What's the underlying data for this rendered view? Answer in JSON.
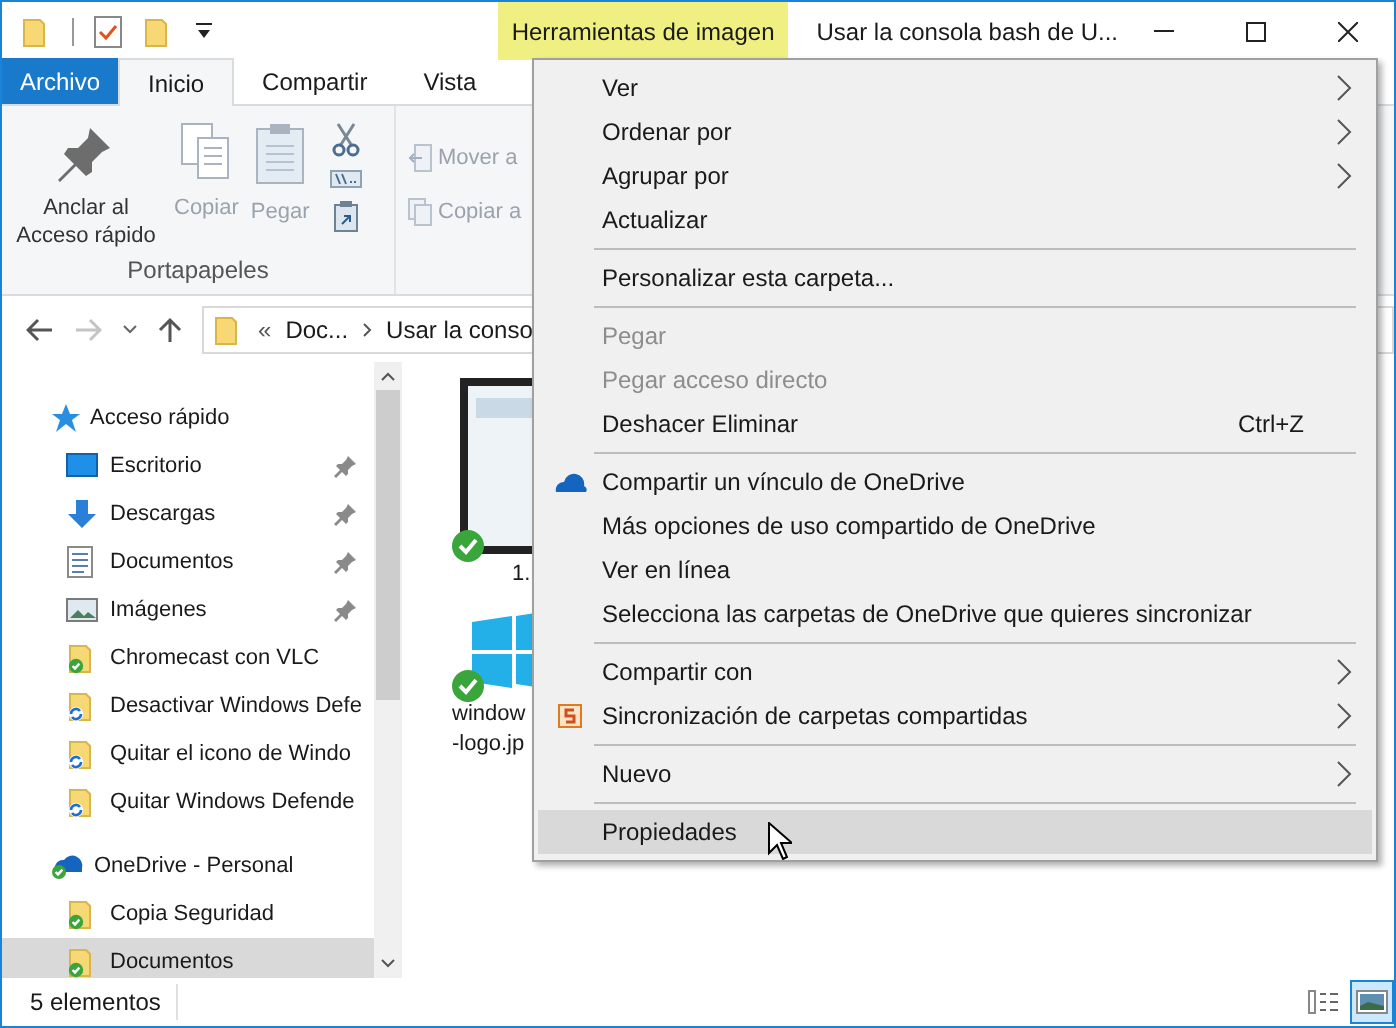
{
  "window": {
    "title": "Usar la consola bash de U...",
    "context_tab": "Herramientas de imagen"
  },
  "file_tab": "Archivo",
  "ribbon_tabs": [
    {
      "label": "Inicio",
      "selected": true
    },
    {
      "label": "Compartir",
      "selected": false
    },
    {
      "label": "Vista",
      "selected": false
    }
  ],
  "ribbon": {
    "large_buttons": [
      {
        "label": "Anclar al Acceso rápido",
        "kind": "pin",
        "disabled": false
      },
      {
        "label": "Copiar",
        "kind": "copy",
        "disabled": true
      },
      {
        "label": "Pegar",
        "kind": "paste",
        "disabled": true
      }
    ],
    "group_label": "Portapapeles",
    "organize": [
      {
        "label": "Mover a",
        "disabled": true
      },
      {
        "label": "Copiar a",
        "disabled": true
      }
    ]
  },
  "address": {
    "overflow": "«",
    "segments": [
      "Doc...",
      "Usar la conso"
    ],
    "forward_disabled": true
  },
  "sidebar": {
    "items": [
      {
        "label": "Acceso rápido",
        "kind": "quick",
        "children": [
          {
            "label": "Escritorio",
            "kind": "desktop",
            "pinned": true,
            "selected": false
          },
          {
            "label": "Descargas",
            "kind": "download",
            "pinned": true,
            "selected": false
          },
          {
            "label": "Documentos",
            "kind": "document",
            "pinned": true,
            "selected": false
          },
          {
            "label": "Imágenes",
            "kind": "images",
            "pinned": true,
            "selected": false
          },
          {
            "label": "Chromecast con VLC",
            "kind": "synced",
            "pinned": false,
            "selected": false
          },
          {
            "label": "Desactivar Windows Defe",
            "kind": "syncing",
            "pinned": false,
            "selected": false
          },
          {
            "label": "Quitar el icono de Windo",
            "kind": "syncing",
            "pinned": false,
            "selected": false
          },
          {
            "label": "Quitar Windows Defende",
            "kind": "syncing",
            "pinned": false,
            "selected": false
          }
        ]
      },
      {
        "label": "OneDrive - Personal",
        "kind": "cloud",
        "children": [
          {
            "label": "Copia Seguridad",
            "kind": "synced",
            "pinned": false,
            "selected": false
          },
          {
            "label": "Documentos",
            "kind": "synced",
            "pinned": false,
            "selected": true
          }
        ]
      }
    ]
  },
  "files": [
    {
      "kind": "screenshot",
      "lines": [
        "1."
      ]
    },
    {
      "kind": "windows",
      "lines": [
        "window",
        "-logo.jp"
      ]
    }
  ],
  "context_menu": [
    {
      "kind": "item",
      "label": "Ver",
      "submenu": true,
      "disabled": false,
      "selected": false
    },
    {
      "kind": "item",
      "label": "Ordenar por",
      "submenu": true,
      "disabled": false,
      "selected": false
    },
    {
      "kind": "item",
      "label": "Agrupar por",
      "submenu": true,
      "disabled": false,
      "selected": false
    },
    {
      "kind": "item",
      "label": "Actualizar",
      "submenu": false,
      "disabled": false,
      "selected": false
    },
    {
      "kind": "separator"
    },
    {
      "kind": "item",
      "label": "Personalizar esta carpeta...",
      "submenu": false,
      "disabled": false,
      "selected": false
    },
    {
      "kind": "separator"
    },
    {
      "kind": "item",
      "label": "Pegar",
      "submenu": false,
      "disabled": true,
      "selected": false
    },
    {
      "kind": "item",
      "label": "Pegar acceso directo",
      "submenu": false,
      "disabled": true,
      "selected": false
    },
    {
      "kind": "item",
      "label": "Deshacer Eliminar",
      "shortcut": "Ctrl+Z",
      "submenu": false,
      "disabled": false,
      "selected": false
    },
    {
      "kind": "separator"
    },
    {
      "kind": "onedrive",
      "label": "Compartir un vínculo de OneDrive",
      "submenu": false,
      "disabled": false,
      "selected": false
    },
    {
      "kind": "item",
      "label": "Más opciones de uso compartido de OneDrive",
      "submenu": false,
      "disabled": false,
      "selected": false
    },
    {
      "kind": "item",
      "label": "Ver en línea",
      "submenu": false,
      "disabled": false,
      "selected": false
    },
    {
      "kind": "item",
      "label": "Selecciona las carpetas de OneDrive que quieres sincronizar",
      "submenu": false,
      "disabled": false,
      "selected": false
    },
    {
      "kind": "separator"
    },
    {
      "kind": "item",
      "label": "Compartir con",
      "submenu": true,
      "disabled": false,
      "selected": false
    },
    {
      "kind": "sync",
      "label": "Sincronización de carpetas compartidas",
      "submenu": true,
      "disabled": false,
      "selected": false
    },
    {
      "kind": "separator"
    },
    {
      "kind": "item",
      "label": "Nuevo",
      "submenu": true,
      "disabled": false,
      "selected": false
    },
    {
      "kind": "separator"
    },
    {
      "kind": "item",
      "label": "Propiedades",
      "submenu": false,
      "disabled": false,
      "selected": true
    }
  ],
  "status_bar": {
    "count": "5 elementos",
    "views": [
      {
        "kind": "details",
        "selected": false
      },
      {
        "kind": "thumbnails",
        "selected": true
      }
    ]
  }
}
